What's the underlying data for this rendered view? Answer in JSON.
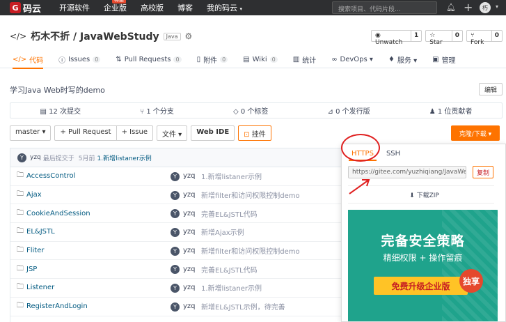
{
  "topnav": {
    "logo_text": "码云",
    "items": [
      "开源软件",
      "企业版",
      "高校版",
      "博客",
      "我的码云"
    ],
    "enterprise_badge": "特惠",
    "search_placeholder": "搜索项目、代码片段...",
    "avatar_text": "朽"
  },
  "repo": {
    "name": "朽木不折 / JavaWebStudy",
    "lang": "Java",
    "watch": {
      "label": "Unwatch",
      "count": "1"
    },
    "star": {
      "label": "Star",
      "count": "0"
    },
    "fork": {
      "label": "Fork",
      "count": "0"
    }
  },
  "tabs": [
    {
      "label": "代码",
      "icon": "</>",
      "count": ""
    },
    {
      "label": "Issues",
      "icon": "ⓘ",
      "count": "0"
    },
    {
      "label": "Pull Requests",
      "icon": "⇅",
      "count": "0"
    },
    {
      "label": "附件",
      "icon": "▯",
      "count": "0"
    },
    {
      "label": "Wiki",
      "icon": "▤",
      "count": "0"
    },
    {
      "label": "统计",
      "icon": "▥",
      "count": ""
    },
    {
      "label": "DevOps ▾",
      "icon": "∞",
      "count": ""
    },
    {
      "label": "服务 ▾",
      "icon": "♦",
      "count": ""
    },
    {
      "label": "管理",
      "icon": "▣",
      "count": ""
    }
  ],
  "description": "学习Java Web时写的demo",
  "edit_label": "编辑",
  "stats": [
    {
      "icon": "▤",
      "num": "12",
      "label": "次提交"
    },
    {
      "icon": "⑂",
      "num": "1",
      "label": "个分支"
    },
    {
      "icon": "◇",
      "num": "0",
      "label": "个标签"
    },
    {
      "icon": "⊿",
      "num": "0",
      "label": "个发行版"
    },
    {
      "icon": "♟",
      "num": "1",
      "label": "位贡献者"
    }
  ],
  "toolbar": {
    "branch": "master ▾",
    "pull_request": "+ Pull Request",
    "issue": "+ Issue",
    "file": "文件 ▾",
    "webide": "Web IDE",
    "widget": "挂件",
    "clone": "克隆/下载 ▾"
  },
  "last_commit": {
    "author": "yzq",
    "prefix": "最后提交于",
    "time": "5月前",
    "message": "1.新增listaner示例"
  },
  "files": [
    {
      "name": "AccessControl",
      "author": "yzq",
      "msg": "1.新增listaner示例"
    },
    {
      "name": "Ajax",
      "author": "yzq",
      "msg": "新增filter和访问权限控制demo"
    },
    {
      "name": "CookieAndSession",
      "author": "yzq",
      "msg": "完善EL&JSTL代码"
    },
    {
      "name": "EL&JSTL",
      "author": "yzq",
      "msg": "新增Ajax示例"
    },
    {
      "name": "Fliter",
      "author": "yzq",
      "msg": "新增filter和访问权限控制demo"
    },
    {
      "name": "JSP",
      "author": "yzq",
      "msg": "完善EL&JSTL代码"
    },
    {
      "name": "Listener",
      "author": "yzq",
      "msg": "1.新增listaner示例"
    },
    {
      "name": "RegisterAndLogin",
      "author": "yzq",
      "msg": "新增EL&JSTL示例，待完善"
    }
  ],
  "clone_dropdown": {
    "tab_https": "HTTPS",
    "tab_ssh": "SSH",
    "url": "https://gitee.com/yuzhiqiang/JavaWebStudy.git",
    "copy": "复制",
    "zip": "下载ZIP"
  },
  "ad": {
    "title": "完备安全策略",
    "subtitle": "精细权限 + 操作留痕",
    "button": "免费升级企业版",
    "badge": "独享"
  },
  "colors": {
    "accent": "#fe7300",
    "brand_red": "#c71d23",
    "nav_bg": "#2e2f31",
    "link": "#005980",
    "ad_bg": "#1fa38c"
  }
}
